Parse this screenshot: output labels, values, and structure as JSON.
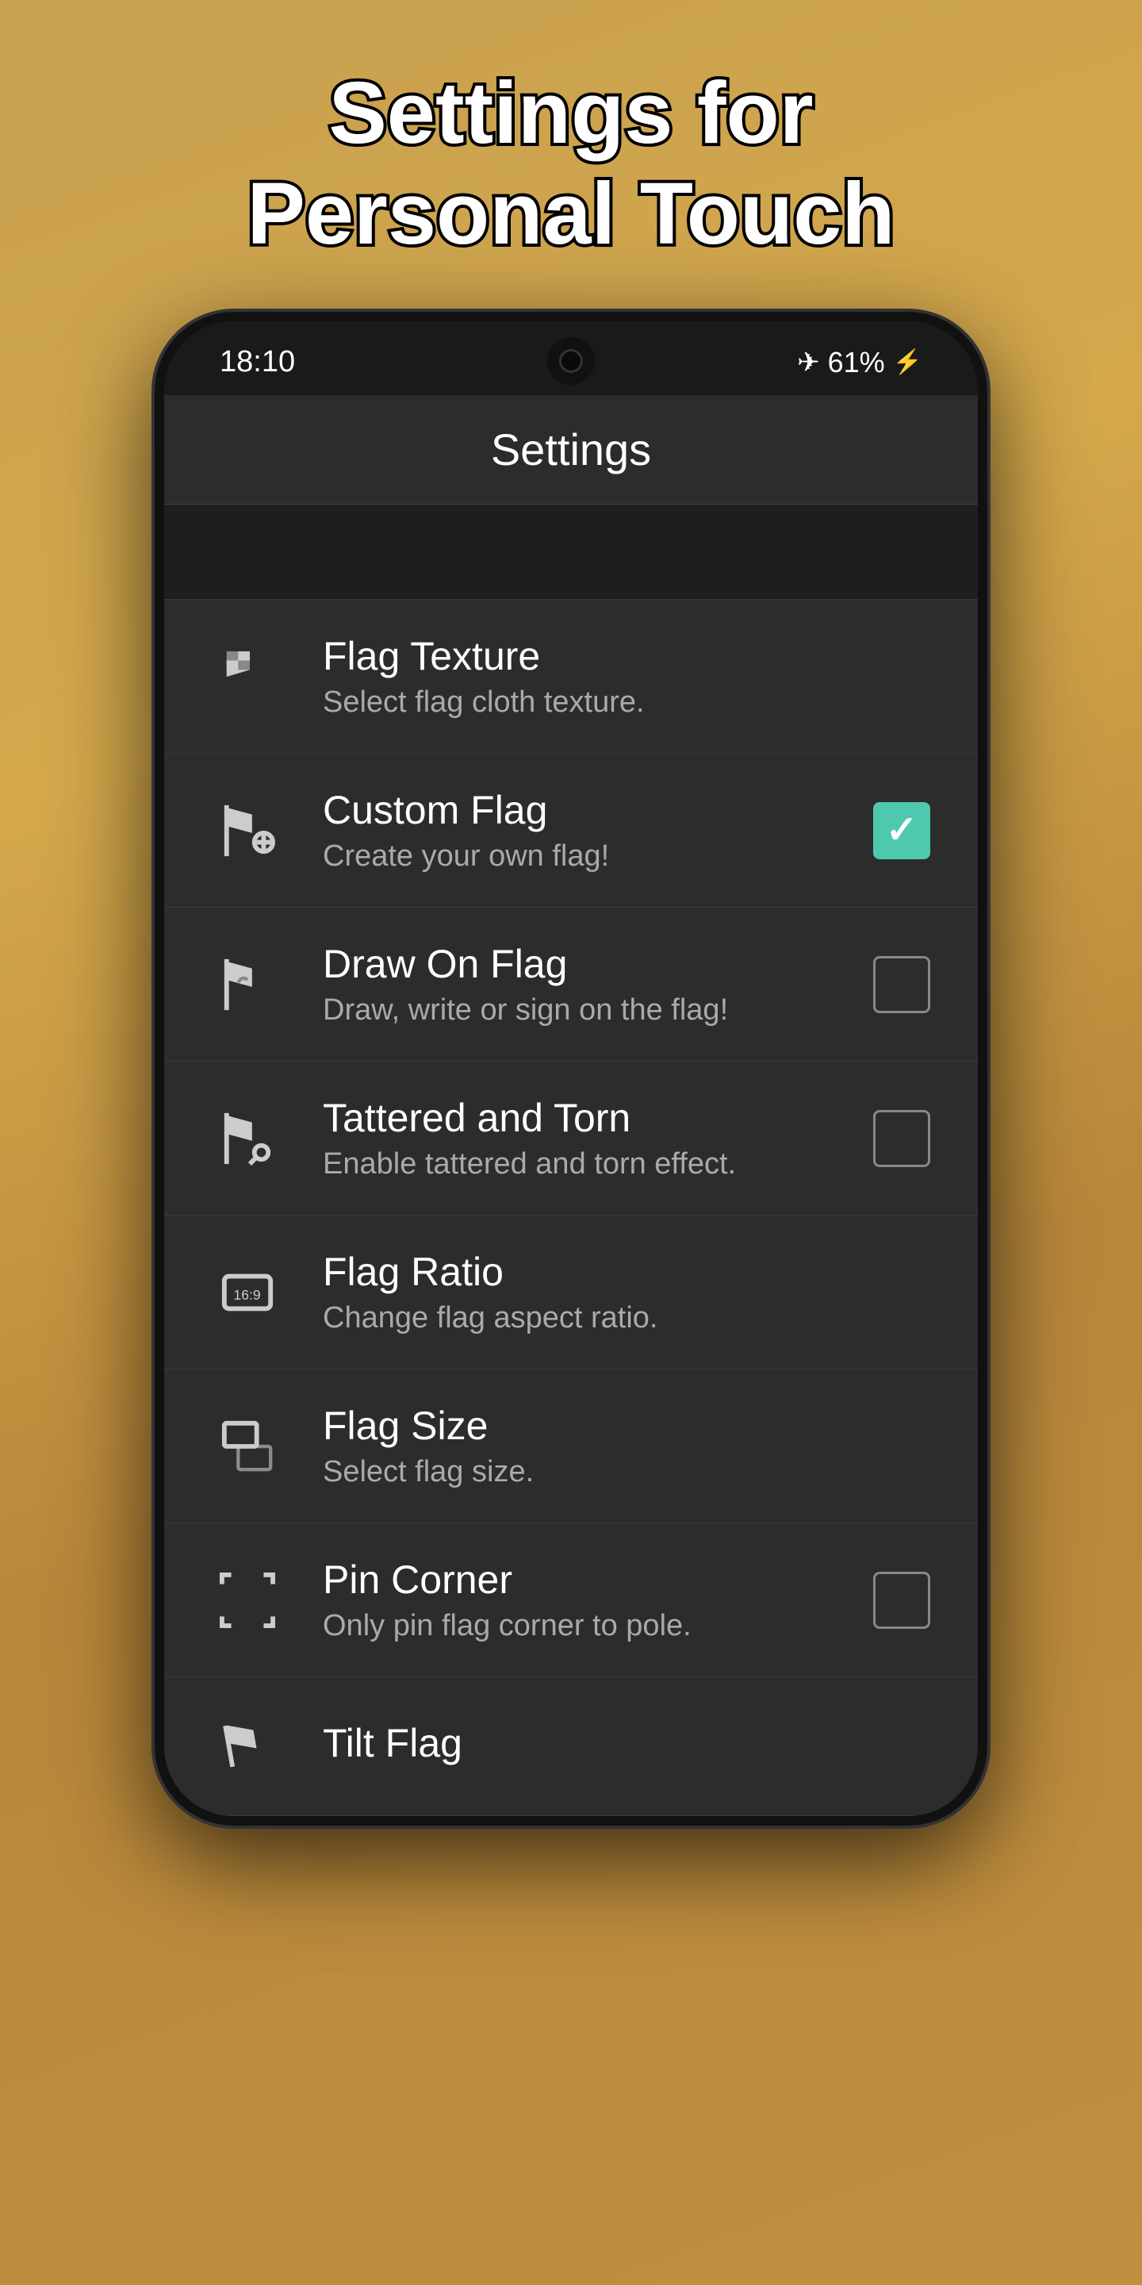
{
  "page": {
    "title_line1": "Settings for",
    "title_line2": "Personal Touch"
  },
  "status_bar": {
    "time": "18:10",
    "battery": "61%",
    "airplane_mode": true
  },
  "app_bar": {
    "title": "Settings"
  },
  "settings_items": [
    {
      "id": "flag-texture",
      "title": "Flag Texture",
      "subtitle": "Select flag cloth texture.",
      "has_checkbox": false,
      "checked": null,
      "icon": "flag-texture"
    },
    {
      "id": "custom-flag",
      "title": "Custom Flag",
      "subtitle": "Create your own flag!",
      "has_checkbox": true,
      "checked": true,
      "icon": "flag-plus"
    },
    {
      "id": "draw-on-flag",
      "title": "Draw On Flag",
      "subtitle": "Draw, write or sign on the flag!",
      "has_checkbox": true,
      "checked": false,
      "icon": "flag-draw"
    },
    {
      "id": "tattered-torn",
      "title": "Tattered and Torn",
      "subtitle": "Enable tattered and torn effect.",
      "has_checkbox": true,
      "checked": false,
      "icon": "flag-torn"
    },
    {
      "id": "flag-ratio",
      "title": "Flag Ratio",
      "subtitle": "Change flag aspect ratio.",
      "has_checkbox": false,
      "checked": null,
      "icon": "aspect-ratio"
    },
    {
      "id": "flag-size",
      "title": "Flag Size",
      "subtitle": "Select flag size.",
      "has_checkbox": false,
      "checked": null,
      "icon": "flag-size"
    },
    {
      "id": "pin-corner",
      "title": "Pin Corner",
      "subtitle": "Only pin flag corner to pole.",
      "has_checkbox": true,
      "checked": false,
      "icon": "expand"
    },
    {
      "id": "tilt-flag",
      "title": "Tilt Flag",
      "subtitle": "",
      "has_checkbox": false,
      "checked": null,
      "icon": "flag-tilt"
    }
  ]
}
